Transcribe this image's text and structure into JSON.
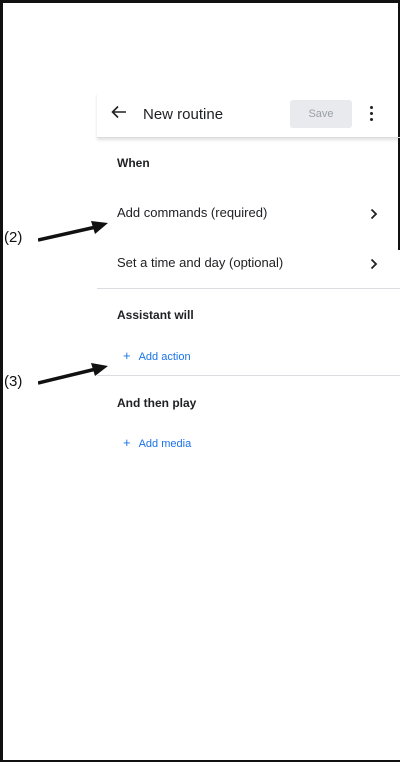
{
  "header": {
    "title": "New routine",
    "save_label": "Save",
    "back_icon": "arrow-back-icon",
    "more_icon": "more-vert-icon"
  },
  "sections": {
    "when": {
      "heading": "When",
      "rows": [
        {
          "label": "Add commands (required)",
          "icon": "chevron-right-icon"
        },
        {
          "label": "Set a time and day (optional)",
          "icon": "chevron-right-icon"
        }
      ]
    },
    "assistant": {
      "heading": "Assistant will",
      "add_label": "Add action",
      "plus": "+"
    },
    "then_play": {
      "heading": "And then play",
      "add_label": "Add media",
      "plus": "+"
    }
  },
  "annotations": {
    "label_2": "(2)",
    "label_3": "(3)"
  },
  "colors": {
    "accent": "#1a73e8",
    "save_bg": "#e8eaed",
    "save_text": "#9aa0a6",
    "divider": "#dadce0"
  }
}
